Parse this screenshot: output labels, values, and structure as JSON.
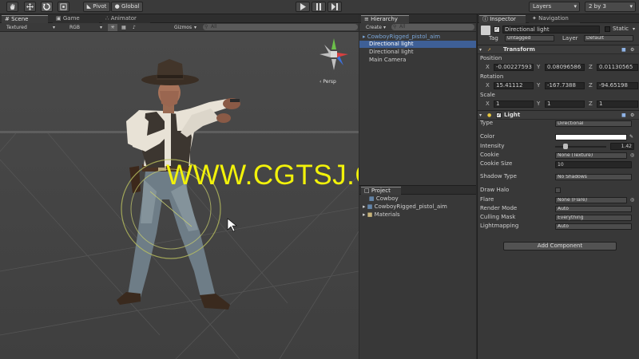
{
  "toolbar": {
    "pivot": "Pivot",
    "global": "Global",
    "layers": "Layers",
    "layout": "2 by 3"
  },
  "scene_tabs": [
    "Scene",
    "Game",
    "Animator"
  ],
  "scene_bar": {
    "mode": "Textured",
    "channel": "RGB",
    "gizmos": "Gizmos",
    "search": "All"
  },
  "scene": {
    "persp": "Persp",
    "watermark": "WWW.CGTSJ.COM"
  },
  "hierarchy": {
    "tab": "Hierarchy",
    "create": "Create",
    "search": "All",
    "items": [
      {
        "label": "CowboyRigged_pistol_aim",
        "color": "#7aa6d8"
      },
      {
        "label": "Directional light",
        "color": "#ffffff"
      },
      {
        "label": "Directional light",
        "color": "#d0d0d0"
      },
      {
        "label": "Main Camera",
        "color": "#d0d0d0"
      }
    ]
  },
  "project": {
    "tab": "Project",
    "items": [
      "Cowboy",
      "CowboyRigged_pistol_aim",
      "Materials"
    ]
  },
  "inspector": {
    "tab": "Inspector",
    "nav_tab": "Navigation",
    "object_name": "Directional light",
    "static": "Static",
    "tag_label": "Tag",
    "tag": "Untagged",
    "layer_label": "Layer",
    "layer": "Default",
    "transform": {
      "title": "Transform",
      "position_label": "Position",
      "position": {
        "x": "-0.00227593",
        "y": "0.08096586",
        "z": "0.01130565"
      },
      "rotation_label": "Rotation",
      "rotation": {
        "x": "15.41112",
        "y": "-167.7388",
        "z": "-94.65198"
      },
      "scale_label": "Scale",
      "scale": {
        "x": "1",
        "y": "1",
        "z": "1"
      }
    },
    "light": {
      "title": "Light",
      "rows": [
        {
          "label": "Type",
          "value": "Directional"
        },
        {
          "label": "Color",
          "value": ""
        },
        {
          "label": "Intensity",
          "value": "1.42"
        },
        {
          "label": "Cookie",
          "value": "None (Texture)"
        },
        {
          "label": "Cookie Size",
          "value": "10"
        },
        {
          "label": "Shadow Type",
          "value": "No Shadows"
        },
        {
          "label": "Draw Halo",
          "value": ""
        },
        {
          "label": "Flare",
          "value": "None (Flare)"
        },
        {
          "label": "Render Mode",
          "value": "Auto"
        },
        {
          "label": "Culling Mask",
          "value": "Everything"
        },
        {
          "label": "Lightmapping",
          "value": "Auto"
        }
      ]
    },
    "add_component": "Add Component"
  }
}
